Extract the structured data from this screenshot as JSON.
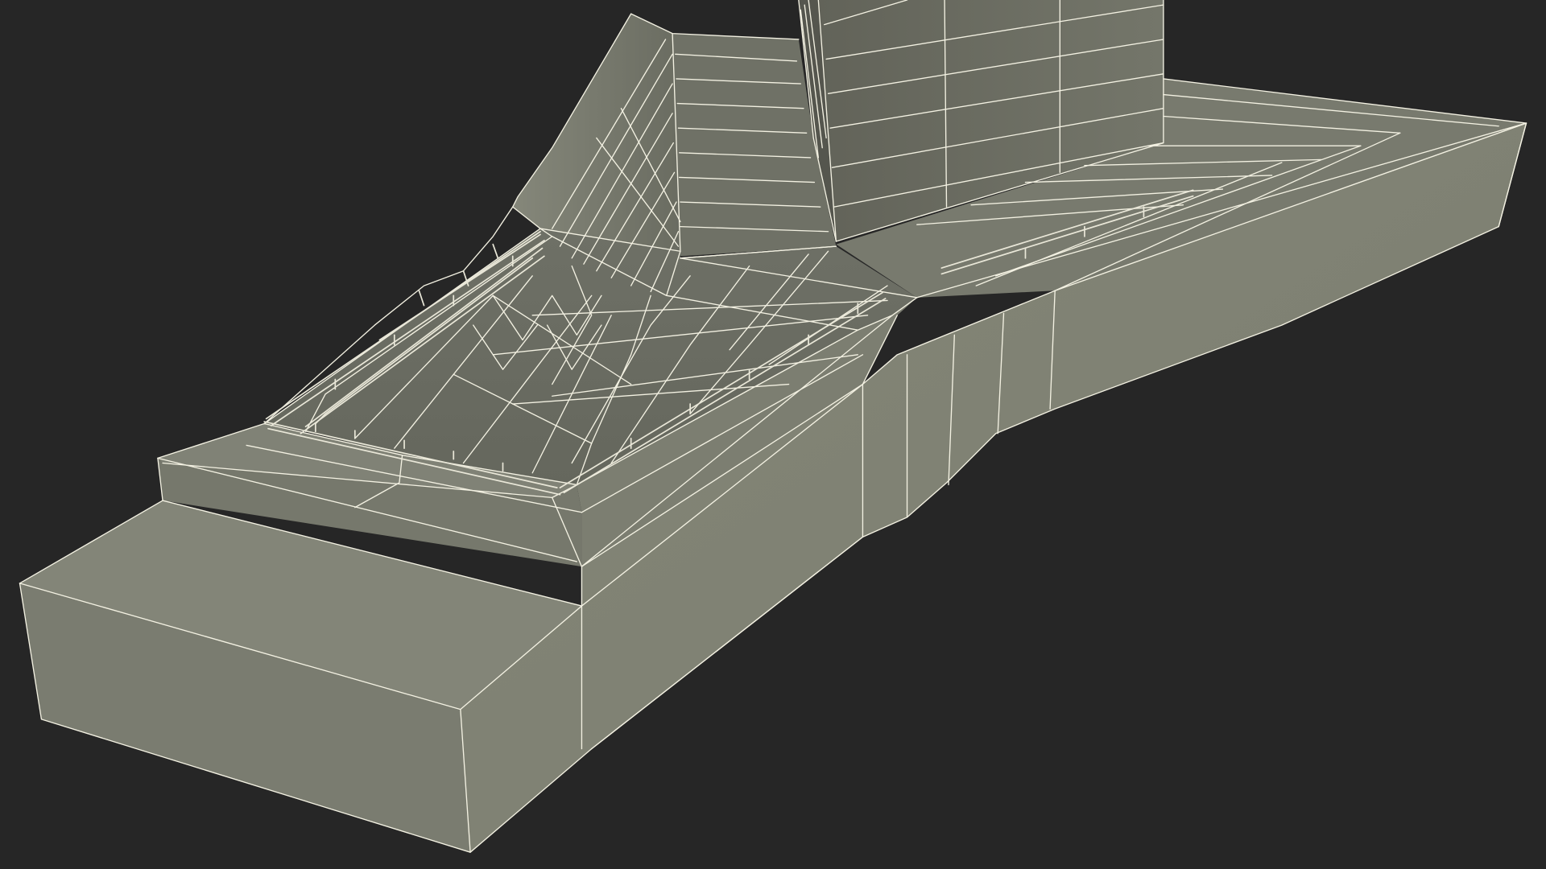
{
  "scene": {
    "background_color": "#262626",
    "surface_color": "#7d7f72",
    "shadow_color": "#5e5f55",
    "wire_color": "#f3f1e2",
    "subject": "wireframe-3d-model"
  }
}
